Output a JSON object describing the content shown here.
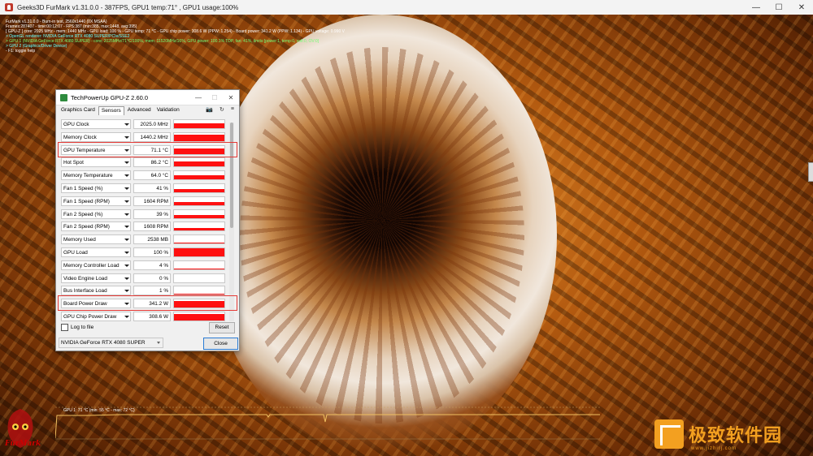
{
  "furmark": {
    "title": "Geeks3D FurMark v1.31.0.0 - 387FPS, GPU1 temp:71° , GPU1 usage:100%",
    "overlay": [
      {
        "text": "FurMark v1.31.0.0 - Burn-in test, 2560x1440 (0X MSAA)",
        "color": "white"
      },
      {
        "text": "Frames:287407 - time:00:12:07 - FPS:387 (min:385, max:1448, avg:395)",
        "color": "white"
      },
      {
        "text": "[ GPU-Z ] core: 2025 MHz - mem: 1440 MHz - GPU load: 100 % - GPU temp: 71 °C - GPU chip power: 308.6 W (PPW: 1.254) - Board power: 341.2 W (PPW: 1.134) - GPU voltage: 0.990 V",
        "color": "white"
      },
      {
        "text": "> OpenGL renderer: NVIDIA GeForce RTX 4080 SUPER/PCIe/SSE2",
        "color": "cyan"
      },
      {
        "text": "> GPU 1 (NVIDIA GeForce RTX 4080 SUPER) - core: 2025MHz/71°C/100%, mem: 11520MHz/16%, GPU power: 100.1% TDP, fan: 41%, limits:[power:1, temp:0, volt:0, OV:0]",
        "color": "green"
      },
      {
        "text": "> GPU 2 (Graphics/Driver Device)",
        "color": "cyan"
      },
      {
        "text": "- F1: toggle help",
        "color": "white"
      }
    ],
    "graph_label": "GPU 1: 71 °C (min: 55 °C - max: 72 °C)",
    "logo_text": "FurMark"
  },
  "watermark": {
    "text": "极致软件园",
    "url": "www.jizhirj.com"
  },
  "gpuz": {
    "title": "TechPowerUp GPU-Z 2.60.0",
    "tabs": [
      "Graphics Card",
      "Sensors",
      "Advanced",
      "Validation"
    ],
    "active_tab": "Sensors",
    "tools": {
      "camera": "📷",
      "refresh": "↻",
      "menu": "≡"
    },
    "sensors": [
      {
        "name": "GPU Clock",
        "value": "2025.0 MHz",
        "fill": 0.62
      },
      {
        "name": "Memory Clock",
        "value": "1440.2 MHz",
        "fill": 0.8
      },
      {
        "name": "GPU Temperature",
        "value": "71.1 °C",
        "fill": 0.62
      },
      {
        "name": "Hot Spot",
        "value": "86.2 °C",
        "fill": 0.66
      },
      {
        "name": "Memory Temperature",
        "value": "64.0 °C",
        "fill": 0.55
      },
      {
        "name": "Fan 1 Speed (%)",
        "value": "41 %",
        "fill": 0.36
      },
      {
        "name": "Fan 1 Speed (RPM)",
        "value": "1604 RPM",
        "fill": 0.36
      },
      {
        "name": "Fan 2 Speed (%)",
        "value": "39 %",
        "fill": 0.34
      },
      {
        "name": "Fan 2 Speed (RPM)",
        "value": "1608 RPM",
        "fill": 0.34
      },
      {
        "name": "Memory Used",
        "value": "2538 MB",
        "fill": 0.12
      },
      {
        "name": "GPU Load",
        "value": "100 %",
        "fill": 1.0
      },
      {
        "name": "Memory Controller Load",
        "value": "4 %",
        "fill": 0.1
      },
      {
        "name": "Video Engine Load",
        "value": "0 %",
        "fill": 0.0
      },
      {
        "name": "Bus Interface Load",
        "value": "1 %",
        "fill": 0.08
      },
      {
        "name": "Board Power Draw",
        "value": "341.2 W",
        "fill": 0.85
      },
      {
        "name": "GPU Chip Power Draw",
        "value": "308.6 W",
        "fill": 0.78
      }
    ],
    "log_label": "Log to file",
    "reset_label": "Reset",
    "gpu_select": "NVIDIA GeForce RTX 4080 SUPER",
    "close_label": "Close"
  }
}
